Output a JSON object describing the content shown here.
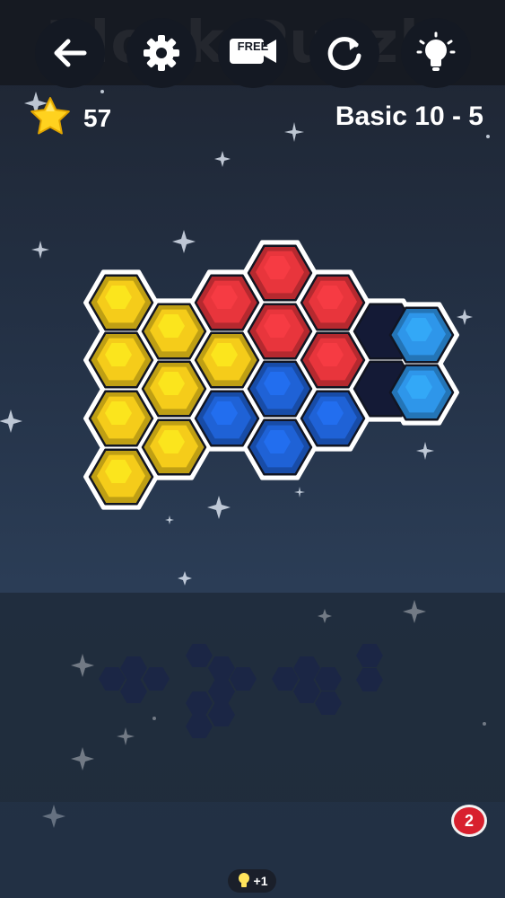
{
  "header": {
    "title": "Block Puzzle"
  },
  "hud": {
    "score": "57",
    "score_icon": "star-icon",
    "level": "Basic 10 - 5"
  },
  "colors": {
    "yellow": "#f5cc1a",
    "red": "#e8353c",
    "blue": "#1f62d6",
    "light_blue": "#2e96ea",
    "empty_slot": "#141a36",
    "accent_badge": "#d8202e"
  },
  "toolbar": {
    "back_icon": "arrow-left-icon",
    "settings_icon": "gear-icon",
    "video_icon": "video-camera-icon",
    "free_label": "FREE",
    "hint_bonus": "+1",
    "restart_icon": "restart-icon",
    "hint_icon": "lightbulb-icon",
    "hint_count": "2"
  }
}
